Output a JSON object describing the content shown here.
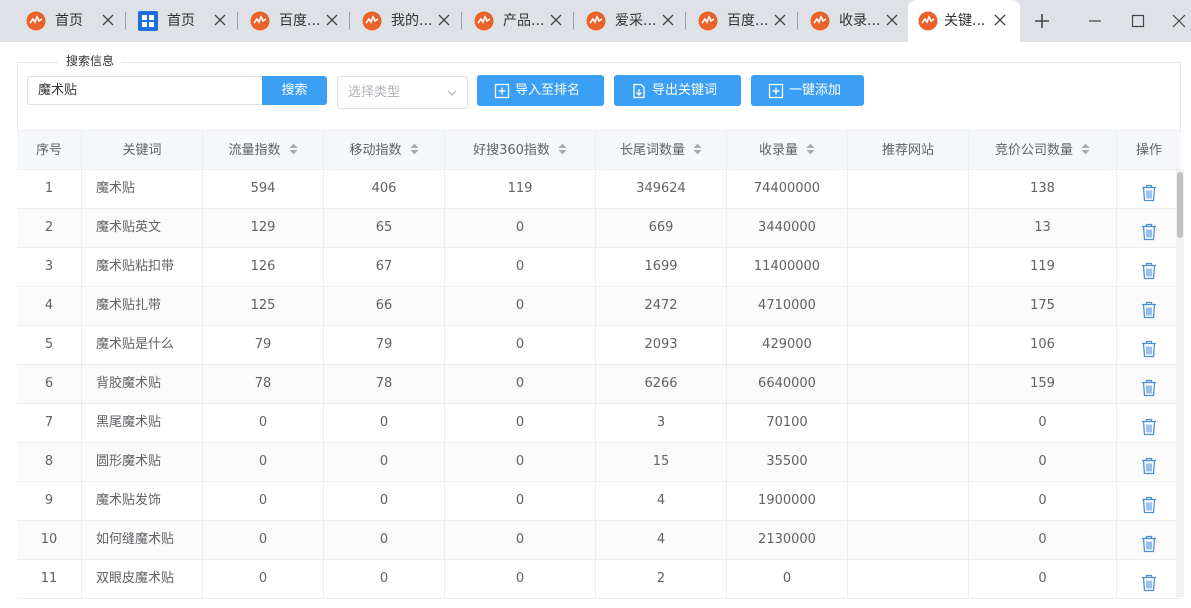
{
  "tabs": [
    {
      "title": "首页",
      "icon": "app-logo-icon"
    },
    {
      "title": "首页",
      "icon": "grid-app-icon"
    },
    {
      "title": "百度...",
      "icon": "app-logo-icon"
    },
    {
      "title": "我的...",
      "icon": "app-logo-icon"
    },
    {
      "title": "产品...",
      "icon": "app-logo-icon"
    },
    {
      "title": "爱采...",
      "icon": "app-logo-icon"
    },
    {
      "title": "百度...",
      "icon": "app-logo-icon"
    },
    {
      "title": "收录...",
      "icon": "app-logo-icon"
    },
    {
      "title": "关键...",
      "icon": "app-logo-icon",
      "active": true
    }
  ],
  "search": {
    "legend": "搜索信息",
    "keyword_value": "魔术贴",
    "search_button": "搜索",
    "type_placeholder": "选择类型",
    "import_button": "导入至排名",
    "export_button": "导出关键词",
    "add_button": "一键添加"
  },
  "table": {
    "headers": [
      "序号",
      "关键词",
      "流量指数",
      "移动指数",
      "好搜360指数",
      "长尾词数量",
      "收录量",
      "推荐网站",
      "竞价公司数量",
      "操作"
    ],
    "rows": [
      {
        "no": "1",
        "keyword": "魔术贴",
        "traffic": "594",
        "mobile": "406",
        "haosou": "119",
        "longtail": "349624",
        "indexed": "74400000",
        "site": "",
        "bidders": "138"
      },
      {
        "no": "2",
        "keyword": "魔术贴英文",
        "traffic": "129",
        "mobile": "65",
        "haosou": "0",
        "longtail": "669",
        "indexed": "3440000",
        "site": "",
        "bidders": "13"
      },
      {
        "no": "3",
        "keyword": "魔术贴粘扣带",
        "traffic": "126",
        "mobile": "67",
        "haosou": "0",
        "longtail": "1699",
        "indexed": "11400000",
        "site": "",
        "bidders": "119"
      },
      {
        "no": "4",
        "keyword": "魔术贴扎带",
        "traffic": "125",
        "mobile": "66",
        "haosou": "0",
        "longtail": "2472",
        "indexed": "4710000",
        "site": "",
        "bidders": "175"
      },
      {
        "no": "5",
        "keyword": "魔术贴是什么",
        "traffic": "79",
        "mobile": "79",
        "haosou": "0",
        "longtail": "2093",
        "indexed": "429000",
        "site": "",
        "bidders": "106"
      },
      {
        "no": "6",
        "keyword": "背胶魔术贴",
        "traffic": "78",
        "mobile": "78",
        "haosou": "0",
        "longtail": "6266",
        "indexed": "6640000",
        "site": "",
        "bidders": "159"
      },
      {
        "no": "7",
        "keyword": "黑尾魔术贴",
        "traffic": "0",
        "mobile": "0",
        "haosou": "0",
        "longtail": "3",
        "indexed": "70100",
        "site": "",
        "bidders": "0"
      },
      {
        "no": "8",
        "keyword": "圆形魔术贴",
        "traffic": "0",
        "mobile": "0",
        "haosou": "0",
        "longtail": "15",
        "indexed": "35500",
        "site": "",
        "bidders": "0"
      },
      {
        "no": "9",
        "keyword": "魔术贴发饰",
        "traffic": "0",
        "mobile": "0",
        "haosou": "0",
        "longtail": "4",
        "indexed": "1900000",
        "site": "",
        "bidders": "0"
      },
      {
        "no": "10",
        "keyword": "如何缝魔术贴",
        "traffic": "0",
        "mobile": "0",
        "haosou": "0",
        "longtail": "4",
        "indexed": "2130000",
        "site": "",
        "bidders": "0"
      },
      {
        "no": "11",
        "keyword": "双眼皮魔术贴",
        "traffic": "0",
        "mobile": "0",
        "haosou": "0",
        "longtail": "2",
        "indexed": "0",
        "site": "",
        "bidders": "0"
      }
    ]
  },
  "colors": {
    "accent": "#3a9ff5",
    "tab_bar": "#dee1e6",
    "logo": "#e8622a",
    "trash": "#4a8fd8"
  }
}
